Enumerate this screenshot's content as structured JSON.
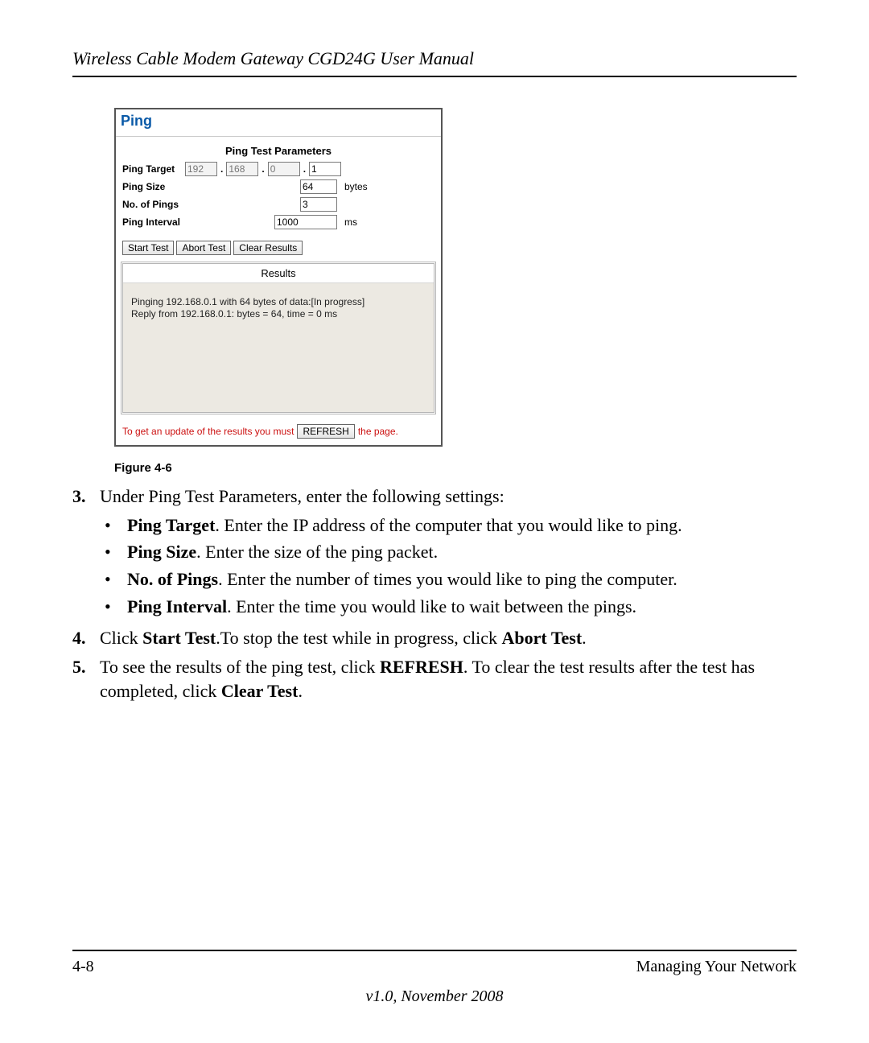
{
  "header": {
    "title": "Wireless Cable Modem Gateway CGD24G User Manual"
  },
  "screenshot": {
    "title": "Ping",
    "section": "Ping Test Parameters",
    "rows": {
      "target_label": "Ping Target",
      "target": {
        "o1": "192",
        "o2": "168",
        "o3": "0",
        "o4": "1"
      },
      "size_label": "Ping Size",
      "size_value": "64",
      "size_unit": "bytes",
      "count_label": "No. of Pings",
      "count_value": "3",
      "interval_label": "Ping Interval",
      "interval_value": "1000",
      "interval_unit": "ms"
    },
    "buttons": {
      "start": "Start Test",
      "abort": "Abort Test",
      "clear": "Clear Results",
      "refresh": "REFRESH"
    },
    "results_header": "Results",
    "results_line1": "Pinging 192.168.0.1 with 64 bytes of data:[In progress]",
    "results_line2": "Reply from 192.168.0.1: bytes = 64, time = 0 ms",
    "hint_pre": "To get an update of the results you must",
    "hint_post": "the page."
  },
  "figure_caption": "Figure 4-6",
  "steps": {
    "s3n": "3.",
    "s3": "Under Ping Test Parameters, enter the following settings:",
    "b1a": "Ping Target",
    "b1b": ". Enter the IP address of the computer that you would like to ping.",
    "b2a": "Ping Size",
    "b2b": ". Enter the size of the ping packet.",
    "b3a": "No. of Pings",
    "b3b": ". Enter the number of times you would like to ping the computer.",
    "b4a": "Ping Interval",
    "b4b": ". Enter the time you would like to wait between the pings.",
    "s4n": "4.",
    "s4a": "Click ",
    "s4b": "Start Test",
    "s4c": ".To stop the test while in progress, click ",
    "s4d": "Abort Test",
    "s4e": ".",
    "s5n": "5.",
    "s5a": "To see the results of the ping test, click ",
    "s5b": "REFRESH",
    "s5c": ". To clear the test results after the test has completed, click ",
    "s5d": "Clear Test",
    "s5e": "."
  },
  "footer": {
    "left": "4-8",
    "right": "Managing Your Network",
    "version": "v1.0, November 2008"
  }
}
